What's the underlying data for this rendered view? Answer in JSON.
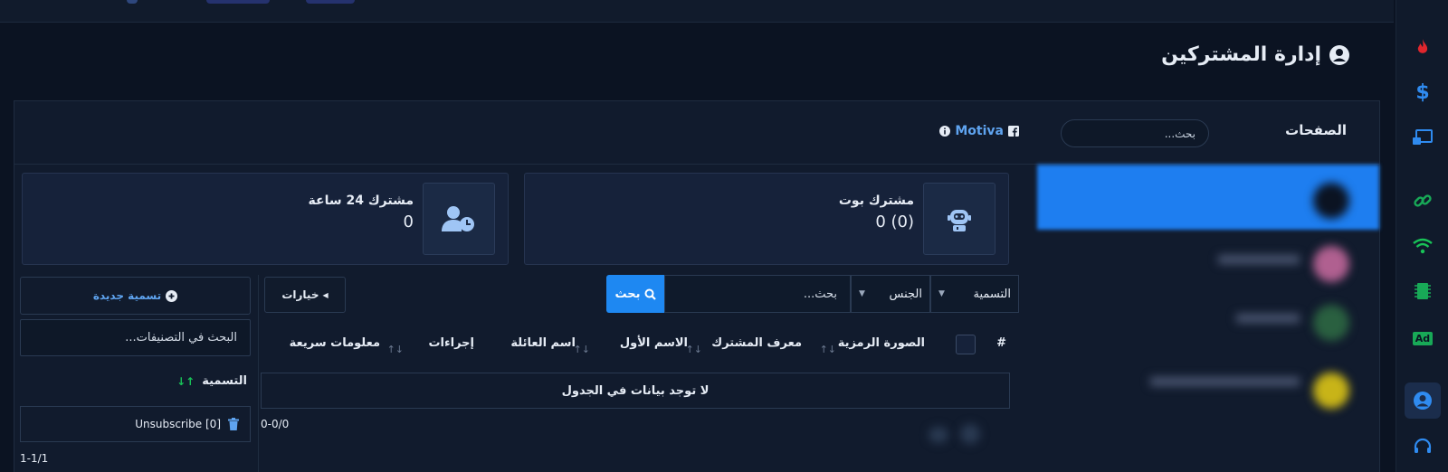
{
  "header": {
    "title": "إدارة المشتركين"
  },
  "pages_panel": {
    "label": "الصفحات",
    "search_placeholder": "بحث...",
    "page_name": "Motiva"
  },
  "stats": [
    {
      "label": "مشترك بوت",
      "value": "0 (0)",
      "icon": "robot-icon"
    },
    {
      "label": "مشترك 24 ساعة",
      "value": "0",
      "icon": "user-clock-icon"
    }
  ],
  "filters": {
    "label_select": "التسمية",
    "gender_select": "الجنس",
    "search_placeholder": "بحث...",
    "search_button": "بحث",
    "options_button": "خيارات"
  },
  "table": {
    "columns": [
      "#",
      "الصورة الرمزية",
      "معرف المشترك",
      "الاسم الأول",
      "اسم العائلة",
      "إجراءات",
      "معلومات سريعة"
    ],
    "empty_text": "لا توجد بيانات في الجدول",
    "pager": "0-0/0"
  },
  "labels_panel": {
    "new_label_button": "تسمية جديدة",
    "search_placeholder": "البحث في التصنيفات...",
    "column_header": "التسمية",
    "rows": [
      {
        "name": "Unsubscribe [0]"
      }
    ],
    "pager": "1-1/1"
  },
  "rail_icons": [
    "fire-icon",
    "dollar-icon",
    "broadcast-icon",
    "link-icon",
    "wifi-icon",
    "chip-icon",
    "ad-icon",
    "user-circle-icon",
    "headset-icon"
  ],
  "colors": {
    "accent": "#1e88f2",
    "background": "#0b1322",
    "panel": "#111b2d"
  }
}
